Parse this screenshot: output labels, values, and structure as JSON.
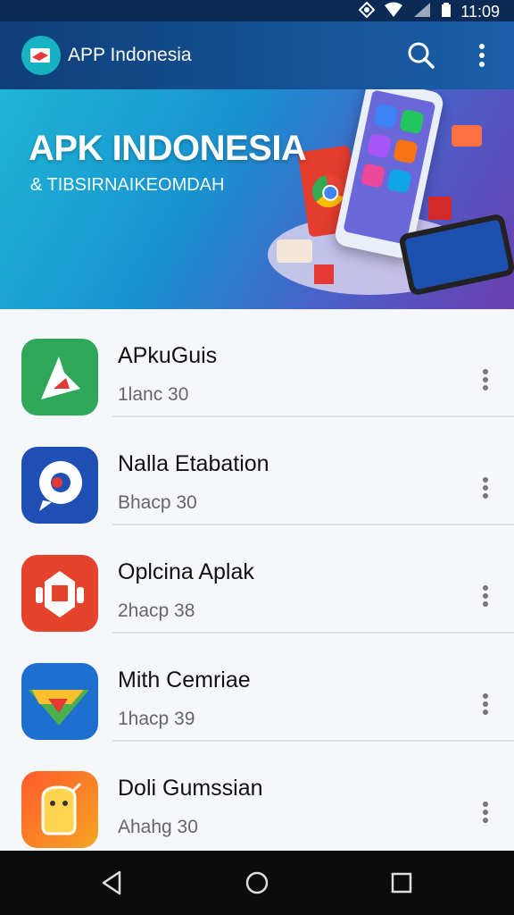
{
  "status_bar": {
    "time": "11:09"
  },
  "app_bar": {
    "title": "APP Indonesia"
  },
  "banner": {
    "title": "APK INDONESIA",
    "subtitle": "& TIBSIRNAIKEOMDAH"
  },
  "apps": [
    {
      "name": "APkuGuis",
      "meta": "1lanc 30",
      "color": "#2fa75a"
    },
    {
      "name": "Nalla Etabation",
      "meta": "Bhacp 30",
      "color": "#1f4fb5"
    },
    {
      "name": "Oplcina Aplak",
      "meta": "2hacp 38",
      "color": "#e5432c"
    },
    {
      "name": "Mith Cemriae",
      "meta": "1hacp 39",
      "color": "#1f6fcf"
    },
    {
      "name": "Doli Gumssian",
      "meta": "Ahahg 30",
      "color": "#f0542a"
    }
  ]
}
